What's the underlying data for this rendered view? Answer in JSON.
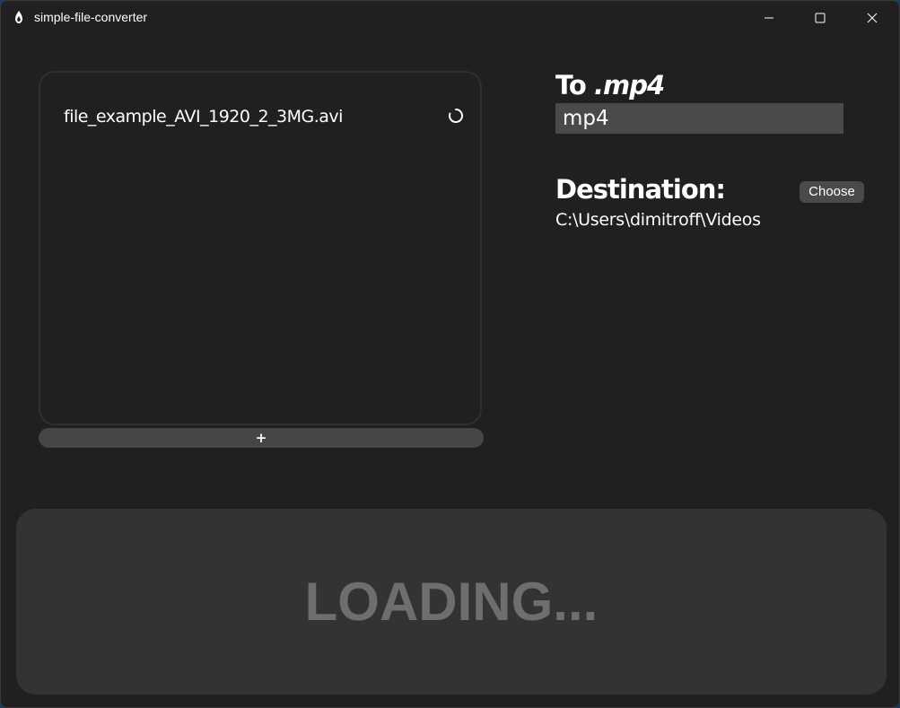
{
  "window": {
    "title": "simple-file-converter",
    "app_icon": "flame-icon",
    "controls": {
      "minimize_icon": "minimize-icon",
      "maximize_icon": "maximize-icon",
      "close_icon": "close-icon"
    }
  },
  "files": {
    "items": [
      {
        "name": "file_example_AVI_1920_2_3MG.avi",
        "status_icon": "spinner-icon"
      }
    ],
    "add_label": "+"
  },
  "target": {
    "prefix": "To ",
    "extension": ".mp4",
    "input_value": "mp4"
  },
  "destination": {
    "label": "Destination:",
    "choose_label": "Choose",
    "path": "C:\\Users\\dimitroff\\Videos"
  },
  "status": {
    "text": "LOADING..."
  },
  "colors": {
    "background": "#202020",
    "panel": "#333333",
    "input": "#4a4a4a",
    "muted_text": "#6e6e6e",
    "text": "#ffffff"
  }
}
